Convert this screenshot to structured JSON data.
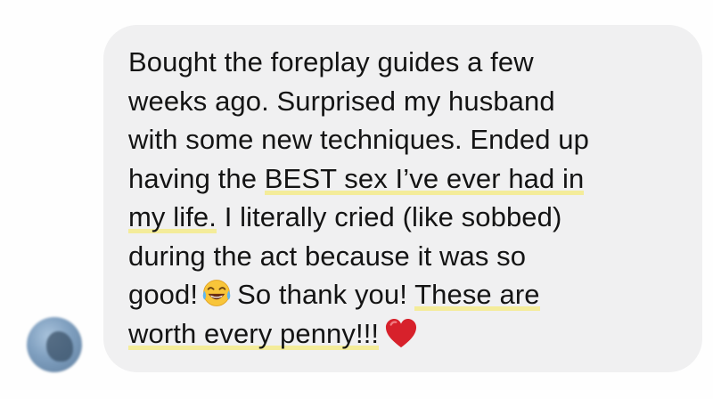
{
  "message": {
    "lines": [
      {
        "parts": [
          {
            "text": "Bought the foreplay guides a few"
          }
        ]
      },
      {
        "parts": [
          {
            "text": "weeks ago. Surprised my husband"
          }
        ]
      },
      {
        "parts": [
          {
            "text": "with some new techniques. Ended up"
          }
        ]
      },
      {
        "parts": [
          {
            "text": "having the "
          },
          {
            "text": "BEST sex I’ve ever had in"
          }
        ]
      },
      {
        "parts": [
          {
            "text": "my life."
          },
          {
            "text": " I literally cried (like sobbed)"
          }
        ]
      },
      {
        "parts": [
          {
            "text": "during the act because it was so"
          }
        ]
      },
      {
        "parts": [
          {
            "text": "good!"
          },
          {
            "text": "So thank you! "
          },
          {
            "text": "These are"
          }
        ]
      },
      {
        "parts": [
          {
            "text": "worth every penny!!!"
          }
        ]
      }
    ]
  },
  "emoji": {
    "laugh": "tears-of-joy-icon",
    "heart": "red-heart-icon"
  },
  "colors": {
    "bubble": "#f0f0f1",
    "highlight": "#f4ec9a",
    "text": "#141414",
    "heart": "#d7212b"
  }
}
